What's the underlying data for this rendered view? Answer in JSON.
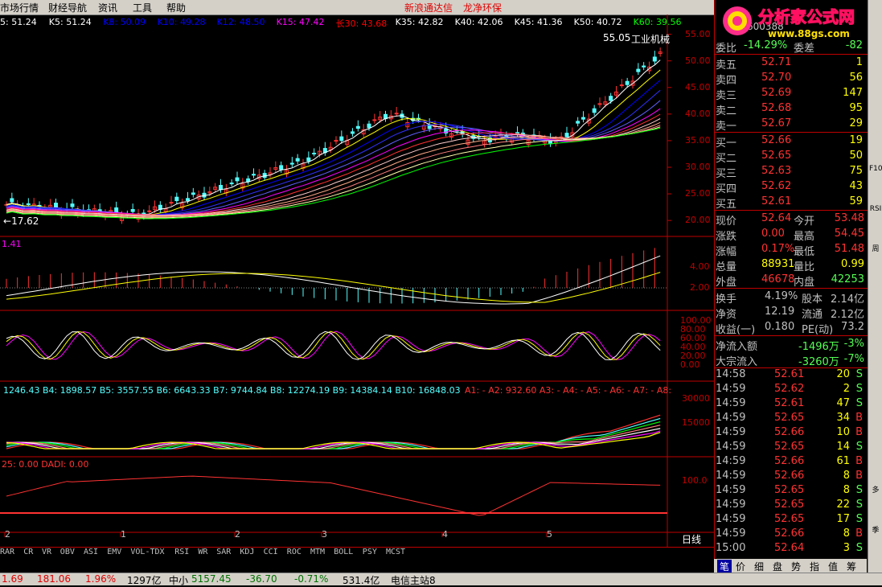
{
  "menu": {
    "items": [
      "市场行情",
      "财经导航",
      "资讯",
      "工具",
      "帮助"
    ],
    "center_items": [
      "新浪通达信",
      "龙净环保"
    ]
  },
  "ma_line": {
    "labels": [
      {
        "text": "5: 51.24",
        "color": "#ffffff"
      },
      {
        "text": "K5: 51.24",
        "color": "#ffffff"
      },
      {
        "text": "K8: 50.09",
        "color": "#0000ff"
      },
      {
        "text": "K10: 49.28",
        "color": "#0000ff"
      },
      {
        "text": "K12: 48.50",
        "color": "#0000ff"
      },
      {
        "text": "K15: 47.42",
        "color": "#ff00ff"
      },
      {
        "text": "长30: 43.68",
        "color": "#ff0000"
      },
      {
        "text": "K35: 42.82",
        "color": "#ffffff"
      },
      {
        "text": "K40: 42.06",
        "color": "#ffffff"
      },
      {
        "text": "K45: 41.36",
        "color": "#ffffff"
      },
      {
        "text": "K50: 40.72",
        "color": "#ffffff"
      },
      {
        "text": "K60: 39.56",
        "color": "#00ff00"
      }
    ]
  },
  "price_axis": {
    "ticks": [
      "55.00",
      "50.00",
      "45.00",
      "40.00",
      "35.00",
      "30.00",
      "25.00",
      "20.00"
    ]
  },
  "price_annotations": {
    "high": "55.05",
    "low": "17.62",
    "sector": "工业机械"
  },
  "macd": {
    "label": "1.41",
    "ticks": [
      "4.00",
      "2.00"
    ]
  },
  "kdj": {
    "ticks": [
      "100.00",
      "80.00",
      "60.00",
      "40.00",
      "20.00",
      "0.00"
    ]
  },
  "vol_panel": {
    "label": "1246.43  B4: 1898.57  B5: 3557.55  B6: 6643.33  B7: 9744.84  B8: 12274.19  B9: 14384.14  B10: 16848.03",
    "label_b": "A1: -  A2: 932.60  A3: -  A4: -  A5: -  A6: -  A7: -  A8:",
    "ticks": [
      "30000",
      "15000"
    ]
  },
  "dadi_panel": {
    "label": "25: 0.00  DADI: 0.00",
    "ticks": [
      "100.0"
    ]
  },
  "x_axis": {
    "labels": [
      "2",
      "1",
      "2",
      "3",
      "4",
      "5"
    ],
    "period": "日线"
  },
  "tabs": [
    "RAR",
    "CR",
    "VR",
    "OBV",
    "ASI",
    "EMV",
    "VOL-TDX",
    "RSI",
    "WR",
    "SAR",
    "KDJ",
    "CCI",
    "ROC",
    "MTM",
    "BOLL",
    "PSY",
    "MCST"
  ],
  "quote": {
    "title_code": "600388",
    "weibi": {
      "label": "委比",
      "value": "-14.29%",
      "label2": "委差",
      "value2": "-82"
    },
    "asks": [
      {
        "label": "卖五",
        "price": "52.71",
        "vol": "1"
      },
      {
        "label": "卖四",
        "price": "52.70",
        "vol": "56"
      },
      {
        "label": "卖三",
        "price": "52.69",
        "vol": "147"
      },
      {
        "label": "卖二",
        "price": "52.68",
        "vol": "95"
      },
      {
        "label": "卖一",
        "price": "52.67",
        "vol": "29"
      }
    ],
    "bids": [
      {
        "label": "买一",
        "price": "52.66",
        "vol": "19"
      },
      {
        "label": "买二",
        "price": "52.65",
        "vol": "50"
      },
      {
        "label": "买三",
        "price": "52.63",
        "vol": "75"
      },
      {
        "label": "买四",
        "price": "52.62",
        "vol": "43"
      },
      {
        "label": "买五",
        "price": "52.61",
        "vol": "59"
      }
    ],
    "stats": [
      {
        "l1": "现价",
        "v1": "52.64",
        "l2": "今开",
        "v2": "53.48"
      },
      {
        "l1": "涨跌",
        "v1": "0.00",
        "l2": "最高",
        "v2": "54.45"
      },
      {
        "l1": "涨幅",
        "v1": "0.17%",
        "l2": "最低",
        "v2": "51.48"
      },
      {
        "l1": "总量",
        "v1": "88931",
        "l2": "量比",
        "v2": "0.99"
      },
      {
        "l1": "外盘",
        "v1": "46678",
        "l2": "内盘",
        "v2": "42253"
      }
    ],
    "stats2": [
      {
        "l1": "换手",
        "v1": "4.19%",
        "l2": "股本",
        "v2": "2.14亿"
      },
      {
        "l1": "净资",
        "v1": "12.19",
        "l2": "流通",
        "v2": "2.12亿"
      },
      {
        "l1": "收益(一)",
        "v1": "0.180",
        "l2": "PE(动)",
        "v2": "73.2"
      }
    ],
    "flows": [
      {
        "label": "净流入额",
        "value": "-1496万",
        "pct": "-3%"
      },
      {
        "label": "大宗流入",
        "value": "-3260万",
        "pct": "-7%"
      }
    ],
    "ticks": [
      {
        "t": "14:58",
        "p": "52.61",
        "v": "20",
        "s": "S"
      },
      {
        "t": "14:59",
        "p": "52.62",
        "v": "2",
        "s": "S"
      },
      {
        "t": "14:59",
        "p": "52.61",
        "v": "47",
        "s": "S"
      },
      {
        "t": "14:59",
        "p": "52.65",
        "v": "34",
        "s": "B"
      },
      {
        "t": "14:59",
        "p": "52.66",
        "v": "10",
        "s": "B"
      },
      {
        "t": "14:59",
        "p": "52.65",
        "v": "14",
        "s": "S"
      },
      {
        "t": "14:59",
        "p": "52.66",
        "v": "61",
        "s": "B"
      },
      {
        "t": "14:59",
        "p": "52.66",
        "v": "8",
        "s": "B"
      },
      {
        "t": "14:59",
        "p": "52.65",
        "v": "8",
        "s": "S"
      },
      {
        "t": "14:59",
        "p": "52.65",
        "v": "22",
        "s": "S"
      },
      {
        "t": "14:59",
        "p": "52.65",
        "v": "17",
        "s": "S"
      },
      {
        "t": "14:59",
        "p": "52.66",
        "v": "8",
        "s": "B"
      },
      {
        "t": "15:00",
        "p": "52.64",
        "v": "3",
        "s": "S"
      }
    ],
    "bottom_tabs": [
      "笔",
      "价",
      "细",
      "盘",
      "势",
      "指",
      "值",
      "筹"
    ]
  },
  "logo": {
    "text": "分析家公式网",
    "url": "www.88gs.com"
  },
  "status_bar": {
    "items": [
      {
        "text": "1.69",
        "color": "#e00000"
      },
      {
        "text": "181.06",
        "color": "#e00000"
      },
      {
        "text": "1.96%",
        "color": "#e00000"
      },
      {
        "text": "1297亿",
        "color": "#000000"
      },
      {
        "text": "中小",
        "color": "#000000"
      },
      {
        "text": "5157.45",
        "color": "#007000"
      },
      {
        "text": "-36.70",
        "color": "#007000"
      },
      {
        "text": "-0.71%",
        "color": "#007000"
      },
      {
        "text": "531.4亿",
        "color": "#000000"
      },
      {
        "text": "电信主站8",
        "color": "#000000"
      }
    ]
  },
  "right_toolbar": [
    "F10",
    "RSI",
    "周",
    "多",
    "季"
  ],
  "colors": {
    "up": "#ff3232",
    "down": "#54ffff",
    "grid": "#c00000",
    "axis_text": "#c0c0c0"
  }
}
